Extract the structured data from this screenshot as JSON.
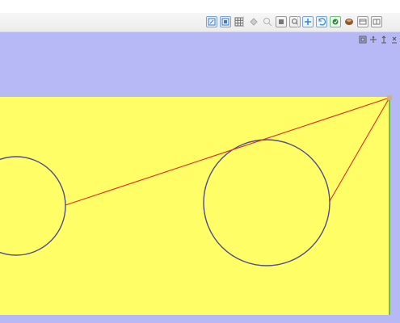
{
  "app": {
    "title": ""
  },
  "toolbar": {
    "left_group": [
      {
        "name": "view-fit-icon",
        "color": "#3f78c6"
      },
      {
        "name": "view-zoom-window-icon",
        "color": "#3f78c6"
      },
      {
        "name": "grid-icon",
        "color": "#6a6a6a"
      }
    ],
    "middle_group": [
      {
        "name": "draw-point-icon",
        "color": "#a8a8a8"
      },
      {
        "name": "zoom-in-icon",
        "color": "#a8a8a8"
      },
      {
        "name": "zoom-box-icon",
        "color": "#5f5f5f"
      },
      {
        "name": "zoom-out-icon",
        "color": "#5f5f5f"
      }
    ],
    "right_group": [
      {
        "name": "selection-mode-icon",
        "color": "#2f87d6"
      },
      {
        "name": "rotate-icon",
        "color": "#2f87d6"
      },
      {
        "name": "render-mode-icon",
        "color": "#2a8a3b"
      },
      {
        "name": "shading-icon",
        "color": "#8b5b2f"
      },
      {
        "name": "panel-icon",
        "color": "#777777"
      },
      {
        "name": "layout-icon",
        "color": "#777777"
      }
    ]
  },
  "viewport": {
    "background": "#b7b8f6",
    "plane_fill": "#fffe66",
    "plane_edge": "#73bb5a",
    "construction_line_color": "#df2a2a",
    "circle_color": "#4f4c8f"
  },
  "corner_tools": [
    {
      "name": "frame-icon"
    },
    {
      "name": "axis-icon"
    },
    {
      "name": "dimension-x-icon"
    },
    {
      "name": "dimension-y-icon"
    }
  ]
}
